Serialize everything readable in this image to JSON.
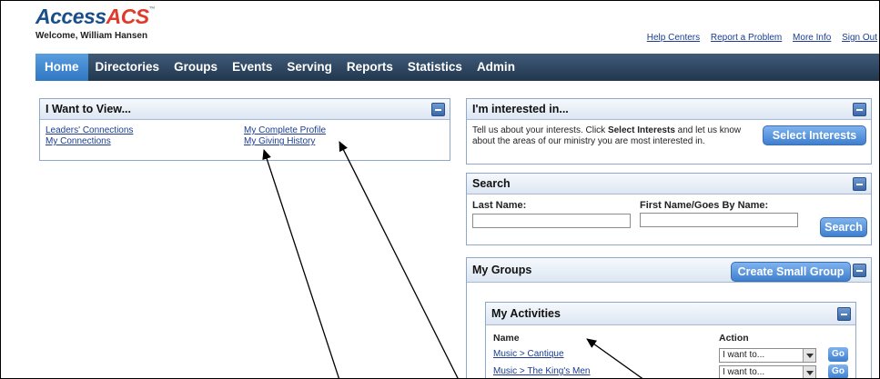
{
  "brand": {
    "part1": "Access",
    "part2": "ACS",
    "mark": "™"
  },
  "welcome": "Welcome, William Hansen",
  "top_links": [
    "Help Centers",
    "Report a Problem",
    "More Info",
    "Sign Out"
  ],
  "nav": [
    "Home",
    "Directories",
    "Groups",
    "Events",
    "Serving",
    "Reports",
    "Statistics",
    "Admin"
  ],
  "i_want": {
    "title": "I Want to View...",
    "links": [
      "Leaders' Connections",
      "My Connections",
      "My Complete Profile",
      "My Giving History"
    ]
  },
  "interested": {
    "title": "I'm interested in...",
    "text_before": "Tell us about your interests. Click ",
    "text_bold": "Select Interests",
    "text_after": " and let us know about the areas of our ministry you are most interested in.",
    "button": "Select Interests"
  },
  "search": {
    "title": "Search",
    "last_name_label": "Last Name:",
    "first_name_label": "First Name/Goes By Name:",
    "button": "Search"
  },
  "my_groups": {
    "title": "My Groups",
    "button": "Create Small Group"
  },
  "my_activities": {
    "title": "My Activities",
    "col_name": "Name",
    "col_action": "Action",
    "rows": [
      {
        "name": "Music > Cantique",
        "action": "I want to...",
        "go": "Go"
      },
      {
        "name": "Music > The King's Men",
        "action": "I want to...",
        "go": "Go"
      }
    ]
  }
}
